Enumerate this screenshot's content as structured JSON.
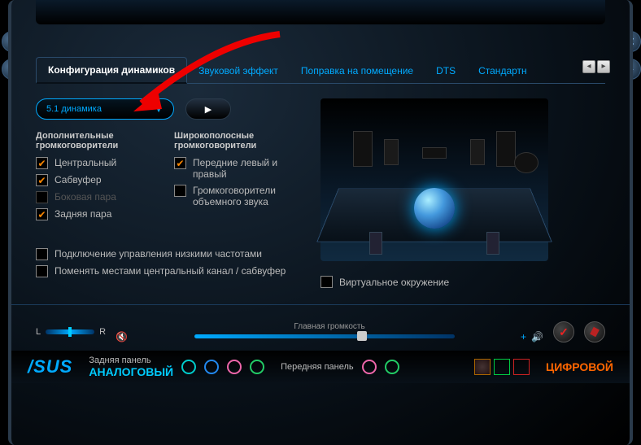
{
  "tabs": {
    "items": [
      "Конфигурация динамиков",
      "Звуковой эффект",
      "Поправка на помещение",
      "DTS",
      "Стандартн"
    ],
    "active": 0
  },
  "dropdown": {
    "label": "5.1 динамика"
  },
  "sections": {
    "additional": {
      "title": "Дополнительные громкоговорители",
      "items": [
        {
          "label": "Центральный",
          "checked": true,
          "disabled": false
        },
        {
          "label": "Сабвуфер",
          "checked": true,
          "disabled": false
        },
        {
          "label": "Боковая пара",
          "checked": false,
          "disabled": true
        },
        {
          "label": "Задняя пара",
          "checked": true,
          "disabled": false
        }
      ]
    },
    "fullrange": {
      "title": "Широкополосные громкоговорители",
      "items": [
        {
          "label": "Передние левый и правый",
          "checked": true,
          "disabled": false
        },
        {
          "label": "Громкоговорители объемного звука",
          "checked": false,
          "disabled": false
        }
      ]
    }
  },
  "lower": {
    "items": [
      {
        "label": "Подключение управления низкими частотами",
        "checked": false
      },
      {
        "label": "Поменять местами центральный канал / сабвуфер",
        "checked": false
      }
    ]
  },
  "virtual": {
    "label": "Виртуальное окружение",
    "checked": false
  },
  "volume": {
    "balance_l": "L",
    "balance_r": "R",
    "label": "Главная громкость",
    "plus": "+"
  },
  "bottom": {
    "brand": "/SUS",
    "rear": "Задняя панель",
    "front": "Передняя панель",
    "analog": "АНАЛОГОВЫЙ",
    "digital": "ЦИФРОВОЙ"
  }
}
